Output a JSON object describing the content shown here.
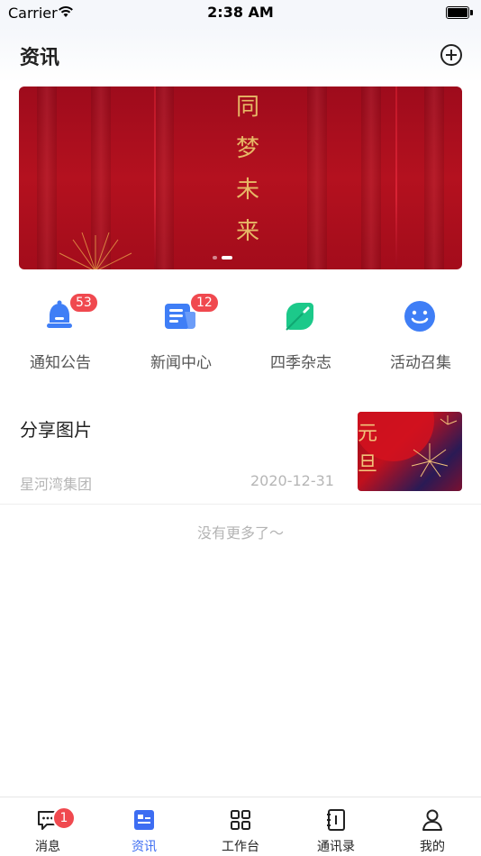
{
  "status": {
    "carrier": "Carrier",
    "time": "2:38 AM"
  },
  "header": {
    "title": "资讯"
  },
  "banner": {
    "chars": [
      "同",
      "梦",
      "未",
      "来"
    ],
    "slide_count": 2,
    "active_slide": 2
  },
  "quick": [
    {
      "label": "通知公告",
      "badge": "53",
      "icon": "bell-icon",
      "color": "#3f7ef6"
    },
    {
      "label": "新闻中心",
      "badge": "12",
      "icon": "newspaper-icon",
      "color": "#3f7ef6"
    },
    {
      "label": "四季杂志",
      "badge": "",
      "icon": "leaf-icon",
      "color": "#1cc98a"
    },
    {
      "label": "活动召集",
      "badge": "",
      "icon": "smile-icon",
      "color": "#3f7ef6"
    }
  ],
  "article": {
    "title": "分享图片",
    "source": "星河湾集团",
    "date": "2020-12-31",
    "thumb_text": "元旦"
  },
  "footer": {
    "no_more": "没有更多了～"
  },
  "tabs": [
    {
      "label": "消息",
      "badge": "1",
      "icon": "chat-icon"
    },
    {
      "label": "资讯",
      "badge": "",
      "icon": "news-icon",
      "active": true
    },
    {
      "label": "工作台",
      "badge": "",
      "icon": "grid-icon"
    },
    {
      "label": "通讯录",
      "badge": "",
      "icon": "contacts-book-icon"
    },
    {
      "label": "我的",
      "badge": "",
      "icon": "person-icon"
    }
  ],
  "colors": {
    "accent": "#3d6df2",
    "badge": "#f0494f",
    "banner_red": "#b4111f",
    "gold": "#e7b866"
  }
}
